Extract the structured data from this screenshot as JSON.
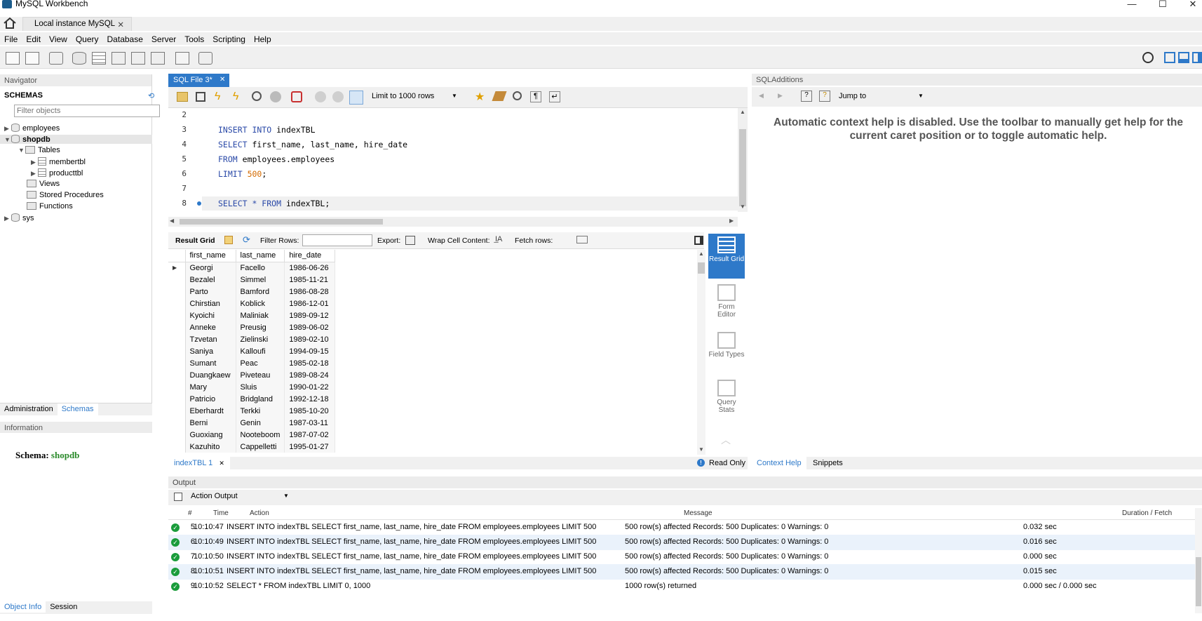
{
  "app": {
    "title": "MySQL Workbench"
  },
  "connection_tab": {
    "label": "Local instance MySQL"
  },
  "menu": [
    "File",
    "Edit",
    "View",
    "Query",
    "Database",
    "Server",
    "Tools",
    "Scripting",
    "Help"
  ],
  "navigator": {
    "header": "Navigator",
    "schemas_title": "SCHEMAS",
    "filter_placeholder": "Filter objects",
    "tree": {
      "employees": "employees",
      "shopdb": "shopdb",
      "tables": "Tables",
      "membertbl": "membertbl",
      "producttbl": "producttbl",
      "views": "Views",
      "stored_procedures": "Stored Procedures",
      "functions": "Functions",
      "sys": "sys"
    },
    "tabs": [
      "Administration",
      "Schemas"
    ],
    "info_header": "Information",
    "schema_label": "Schema:",
    "schema_value": "shopdb",
    "bottom_tabs": [
      "Object Info",
      "Session"
    ]
  },
  "editor": {
    "tab_label": "SQL File 3*",
    "limit_label": "Limit to 1000 rows",
    "lines": [
      {
        "n": "2",
        "code": ""
      },
      {
        "n": "3",
        "code": "INSERT INTO indexTBL"
      },
      {
        "n": "4",
        "code": "SELECT first_name, last_name, hire_date"
      },
      {
        "n": "5",
        "code": "FROM employees.employees"
      },
      {
        "n": "6",
        "code": "LIMIT 500;"
      },
      {
        "n": "7",
        "code": ""
      },
      {
        "n": "8",
        "code": "SELECT * FROM indexTBL;"
      }
    ]
  },
  "result": {
    "toolbar": {
      "result_grid": "Result Grid",
      "filter_rows": "Filter Rows:",
      "export": "Export:",
      "wrap": "Wrap Cell Content:",
      "fetch": "Fetch rows:"
    },
    "columns": [
      "first_name",
      "last_name",
      "hire_date"
    ],
    "rows": [
      [
        "Georgi",
        "Facello",
        "1986-06-26"
      ],
      [
        "Bezalel",
        "Simmel",
        "1985-11-21"
      ],
      [
        "Parto",
        "Bamford",
        "1986-08-28"
      ],
      [
        "Chirstian",
        "Koblick",
        "1986-12-01"
      ],
      [
        "Kyoichi",
        "Maliniak",
        "1989-09-12"
      ],
      [
        "Anneke",
        "Preusig",
        "1989-06-02"
      ],
      [
        "Tzvetan",
        "Zielinski",
        "1989-02-10"
      ],
      [
        "Saniya",
        "Kalloufi",
        "1994-09-15"
      ],
      [
        "Sumant",
        "Peac",
        "1985-02-18"
      ],
      [
        "Duangkaew",
        "Piveteau",
        "1989-08-24"
      ],
      [
        "Mary",
        "Sluis",
        "1990-01-22"
      ],
      [
        "Patricio",
        "Bridgland",
        "1992-12-18"
      ],
      [
        "Eberhardt",
        "Terkki",
        "1985-10-20"
      ],
      [
        "Berni",
        "Genin",
        "1987-03-11"
      ],
      [
        "Guoxiang",
        "Nooteboom",
        "1987-07-02"
      ],
      [
        "Kazuhito",
        "Cappelletti",
        "1995-01-27"
      ]
    ],
    "side": {
      "result_grid": "Result Grid",
      "form_editor": "Form Editor",
      "field_types": "Field Types",
      "query_stats": "Query Stats"
    },
    "tab_label": "indexTBL 1",
    "read_only": "Read Only"
  },
  "sql_additions": {
    "header": "SQLAdditions",
    "jump_to": "Jump to",
    "help_text": "Automatic context help is disabled. Use the toolbar to manually get help for the current caret position or to toggle automatic help.",
    "tabs": [
      "Context Help",
      "Snippets"
    ]
  },
  "output": {
    "header": "Output",
    "selector": "Action Output",
    "columns": {
      "num": "#",
      "time": "Time",
      "action": "Action",
      "message": "Message",
      "duration": "Duration / Fetch"
    },
    "rows": [
      {
        "num": "5",
        "time": "10:10:47",
        "action": "INSERT INTO indexTBL SELECT first_name, last_name, hire_date FROM employees.employees LIMIT 500",
        "message": "500 row(s) affected Records: 500  Duplicates: 0  Warnings: 0",
        "duration": "0.032 sec"
      },
      {
        "num": "6",
        "time": "10:10:49",
        "action": "INSERT INTO indexTBL SELECT first_name, last_name, hire_date FROM employees.employees LIMIT 500",
        "message": "500 row(s) affected Records: 500  Duplicates: 0  Warnings: 0",
        "duration": "0.016 sec"
      },
      {
        "num": "7",
        "time": "10:10:50",
        "action": "INSERT INTO indexTBL SELECT first_name, last_name, hire_date FROM employees.employees LIMIT 500",
        "message": "500 row(s) affected Records: 500  Duplicates: 0  Warnings: 0",
        "duration": "0.000 sec"
      },
      {
        "num": "8",
        "time": "10:10:51",
        "action": "INSERT INTO indexTBL SELECT first_name, last_name, hire_date FROM employees.employees LIMIT 500",
        "message": "500 row(s) affected Records: 500  Duplicates: 0  Warnings: 0",
        "duration": "0.015 sec"
      },
      {
        "num": "9",
        "time": "10:10:52",
        "action": "SELECT * FROM indexTBL LIMIT 0, 1000",
        "message": "1000 row(s) returned",
        "duration": "0.000 sec / 0.000 sec"
      }
    ]
  },
  "colors": {
    "accent": "#2e79c9",
    "ok": "#1a9c3b",
    "keyword": "#2b4aa8",
    "number": "#d36a00",
    "schema": "#2a8a2a"
  }
}
